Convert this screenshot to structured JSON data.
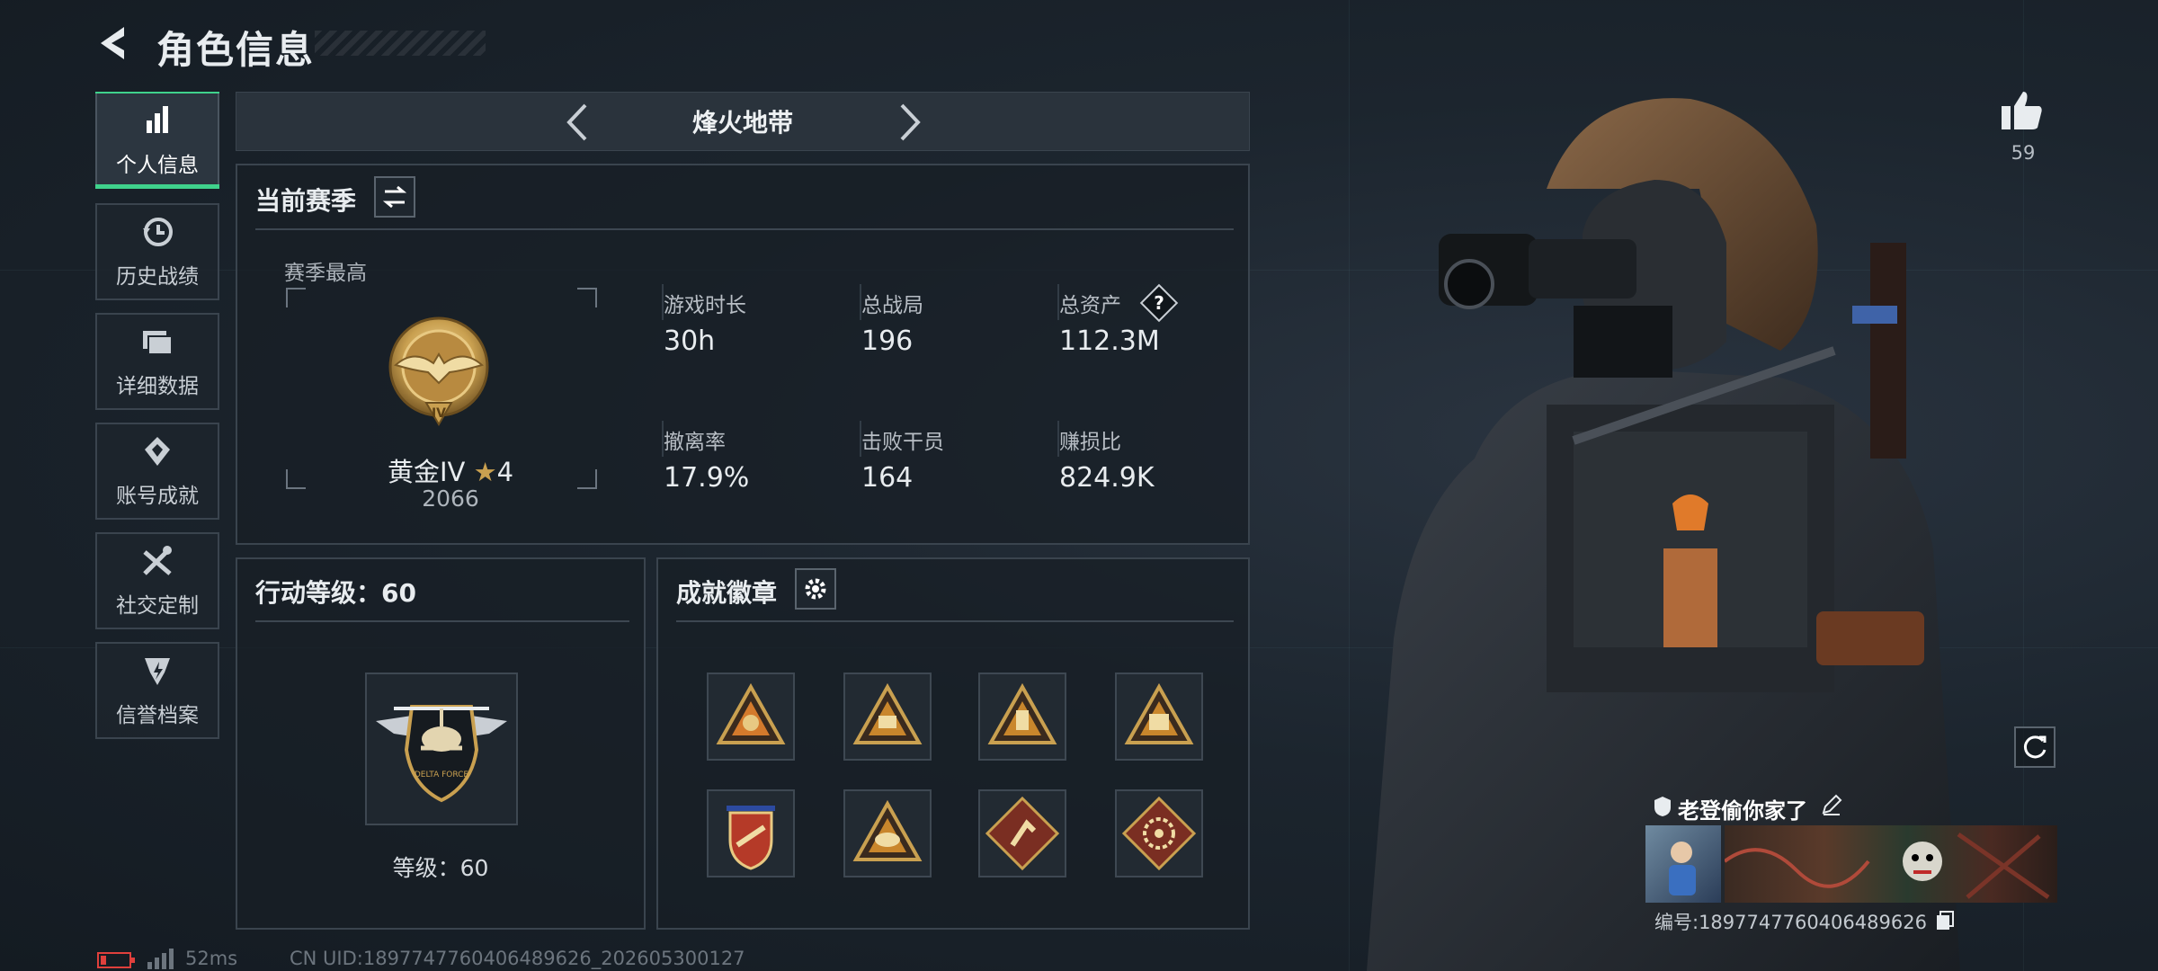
{
  "header": {
    "title": "角色信息"
  },
  "nav": [
    {
      "label": "个人信息",
      "icon": "bar-chart-icon",
      "active": true
    },
    {
      "label": "历史战绩",
      "icon": "history-clock-icon",
      "active": false
    },
    {
      "label": "详细数据",
      "icon": "folder-icon",
      "active": false
    },
    {
      "label": "账号成就",
      "icon": "achievement-icon",
      "active": false
    },
    {
      "label": "社交定制",
      "icon": "tools-icon",
      "active": false
    },
    {
      "label": "信誉档案",
      "icon": "shield-badge-icon",
      "active": false
    }
  ],
  "mode": {
    "label": "烽火地带"
  },
  "season": {
    "title": "当前赛季",
    "best_label": "赛季最高",
    "rank_name": "黄金IV",
    "rank_stars": "4",
    "rank_score": "2066",
    "stats": [
      {
        "label": "游戏时长",
        "value": "30h"
      },
      {
        "label": "总战局",
        "value": "196"
      },
      {
        "label": "总资产",
        "value": "112.3M"
      },
      {
        "label": "撤离率",
        "value": "17.9%"
      },
      {
        "label": "击败干员",
        "value": "164"
      },
      {
        "label": "赚损比",
        "value": "824.9K"
      }
    ],
    "help_symbol": "?"
  },
  "action_level": {
    "title": "行动等级：60",
    "level_text": "等级：60"
  },
  "achievements": {
    "title": "成就徽章",
    "badges": [
      "badge-icon",
      "badge-icon",
      "badge-icon",
      "badge-icon",
      "badge-icon",
      "badge-icon",
      "badge-icon",
      "badge-icon"
    ]
  },
  "profile": {
    "likes": "59",
    "name": "老登偷你家了",
    "id": "编号:1897747760406489626"
  },
  "footer": {
    "ping": "52ms",
    "uid": "CN UID:1897747760406489626_202605300127"
  },
  "colors": {
    "accent": "#3fd28c",
    "gold": "#c9a050",
    "battery": "#e0403c"
  }
}
